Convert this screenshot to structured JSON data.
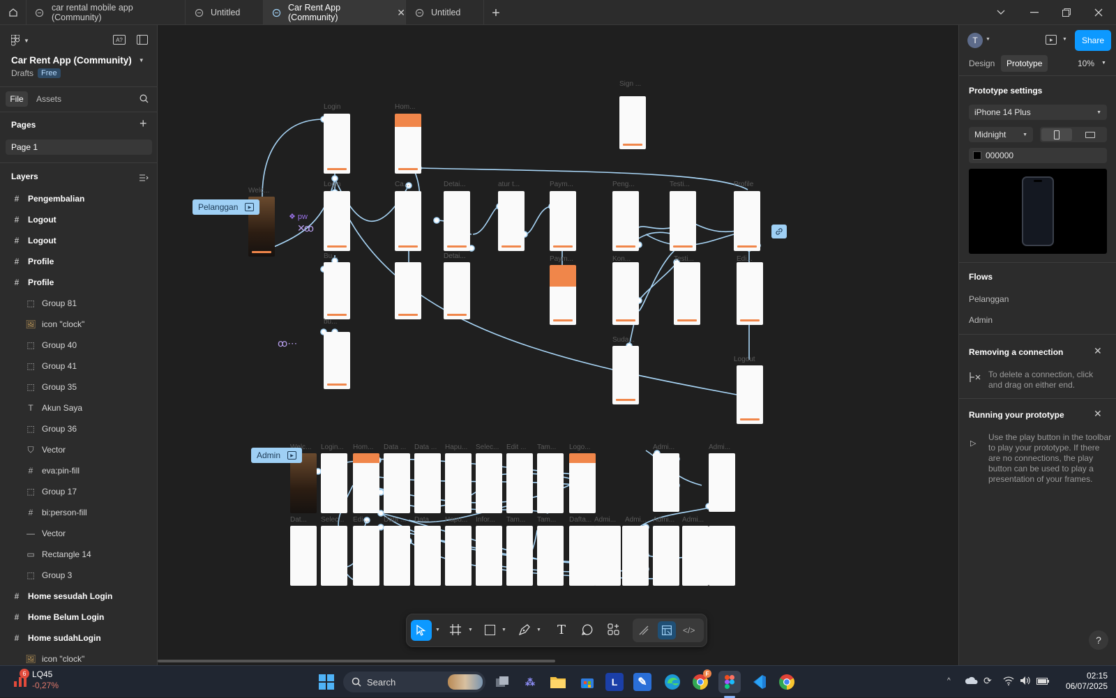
{
  "tabs": [
    {
      "label": "car rental mobile app (Community)",
      "active": false
    },
    {
      "label": "Untitled",
      "active": false
    },
    {
      "label": "Car Rent App (Community)",
      "active": true
    },
    {
      "label": "Untitled",
      "active": false
    }
  ],
  "file": {
    "title": "Car Rent App (Community)",
    "location": "Drafts",
    "plan": "Free"
  },
  "left_tabs": {
    "file": "File",
    "assets": "Assets"
  },
  "pages": {
    "heading": "Pages",
    "items": [
      "Page 1"
    ]
  },
  "layers": {
    "heading": "Layers",
    "items": [
      {
        "label": "Pengembalian",
        "kind": "frame",
        "indent": 0
      },
      {
        "label": "Logout",
        "kind": "frame",
        "indent": 0
      },
      {
        "label": "Logout",
        "kind": "frame",
        "indent": 0
      },
      {
        "label": "Profile",
        "kind": "frame",
        "indent": 0
      },
      {
        "label": "Profile",
        "kind": "frame",
        "indent": 0
      },
      {
        "label": "Group 81",
        "kind": "group",
        "indent": 1
      },
      {
        "label": "icon \"clock\"",
        "kind": "image",
        "indent": 1
      },
      {
        "label": "Group 40",
        "kind": "group",
        "indent": 1
      },
      {
        "label": "Group 41",
        "kind": "group",
        "indent": 1
      },
      {
        "label": "Group 35",
        "kind": "group",
        "indent": 1
      },
      {
        "label": "Akun Saya",
        "kind": "text",
        "indent": 1
      },
      {
        "label": "Group 36",
        "kind": "group",
        "indent": 1
      },
      {
        "label": "Vector",
        "kind": "vector",
        "indent": 1
      },
      {
        "label": "eva:pin-fill",
        "kind": "frame",
        "indent": 1
      },
      {
        "label": "Group 17",
        "kind": "group",
        "indent": 1
      },
      {
        "label": "bi:person-fill",
        "kind": "frame",
        "indent": 1
      },
      {
        "label": "Vector",
        "kind": "line",
        "indent": 1
      },
      {
        "label": "Rectangle 14",
        "kind": "rect",
        "indent": 1
      },
      {
        "label": "Group 3",
        "kind": "group",
        "indent": 1
      },
      {
        "label": "Home sesudah Login",
        "kind": "frame",
        "indent": 0
      },
      {
        "label": "Home Belum Login",
        "kind": "frame",
        "indent": 0
      },
      {
        "label": "Home sudahLogin",
        "kind": "frame",
        "indent": 0
      },
      {
        "label": "icon \"clock\"",
        "kind": "image",
        "indent": 1
      }
    ]
  },
  "canvas": {
    "flows": {
      "pelanggan": "Pelanggan",
      "admin": "Admin"
    },
    "pw": "pw",
    "frame_labels": [
      {
        "t": "Login"
      },
      {
        "t": "Hom..."
      },
      {
        "t": "Sign ..."
      },
      {
        "t": "Welc..."
      },
      {
        "t": "Login"
      },
      {
        "t": "Ca..."
      },
      {
        "t": "Detai..."
      },
      {
        "t": "atur t..."
      },
      {
        "t": "Paym..."
      },
      {
        "t": "Peng..."
      },
      {
        "t": "Testi..."
      },
      {
        "t": "Profile"
      },
      {
        "t": "Bu..."
      },
      {
        "t": "Detai..."
      },
      {
        "t": "Detai..."
      },
      {
        "t": "Paym..."
      },
      {
        "t": "Kon..."
      },
      {
        "t": "Testi..."
      },
      {
        "t": "Edi..."
      },
      {
        "t": "bu..."
      },
      {
        "t": "Suda..."
      },
      {
        "t": "Logout"
      }
    ],
    "admin_labels": [
      {
        "t": "Welc..."
      },
      {
        "t": "Login..."
      },
      {
        "t": "Hom..."
      },
      {
        "t": "Data ..."
      },
      {
        "t": "Data ..."
      },
      {
        "t": "Hapu..."
      },
      {
        "t": "Selec..."
      },
      {
        "t": "Edit ..."
      },
      {
        "t": "Tam..."
      },
      {
        "t": "Logo..."
      },
      {
        "t": "Admi..."
      },
      {
        "t": "Admi..."
      },
      {
        "t": "Dat..."
      },
      {
        "t": "Selec..."
      },
      {
        "t": "Edi..."
      },
      {
        "t": "Data ..."
      },
      {
        "t": "Data ..."
      },
      {
        "t": "Hapu..."
      },
      {
        "t": "Infor..."
      },
      {
        "t": "Tam..."
      },
      {
        "t": "Tam..."
      },
      {
        "t": "Dafta..."
      },
      {
        "t": "Admi..."
      },
      {
        "t": "Admi..."
      },
      {
        "t": "Admi..."
      },
      {
        "t": "Admi..."
      }
    ]
  },
  "right": {
    "avatar": "T",
    "share": "Share",
    "tabs": {
      "design": "Design",
      "prototype": "Prototype"
    },
    "zoom": "10%",
    "settings_heading": "Prototype settings",
    "device": "iPhone 14 Plus",
    "model": "Midnight",
    "bg_hex": "000000",
    "bg_color": "#000000",
    "flows_heading": "Flows",
    "flows": [
      "Pelanggan",
      "Admin"
    ],
    "tip1": {
      "title": "Removing a connection",
      "body": "To delete a connection, click and drag on either end."
    },
    "tip2": {
      "title": "Running your prototype",
      "body": "Use the play button in the toolbar to play your prototype. If there are no connections, the play button can be used to play a presentation of your frames."
    }
  },
  "taskbar": {
    "stock_name": "LQ45",
    "stock_change": "-0,27%",
    "badge": "6",
    "search": "Search",
    "time": "02:15",
    "date": "06/07/2025",
    "figma_badge": "F"
  },
  "colors": {
    "accent": "#0d99ff",
    "connector": "#a9d6f7",
    "orange": "#f0864a"
  }
}
